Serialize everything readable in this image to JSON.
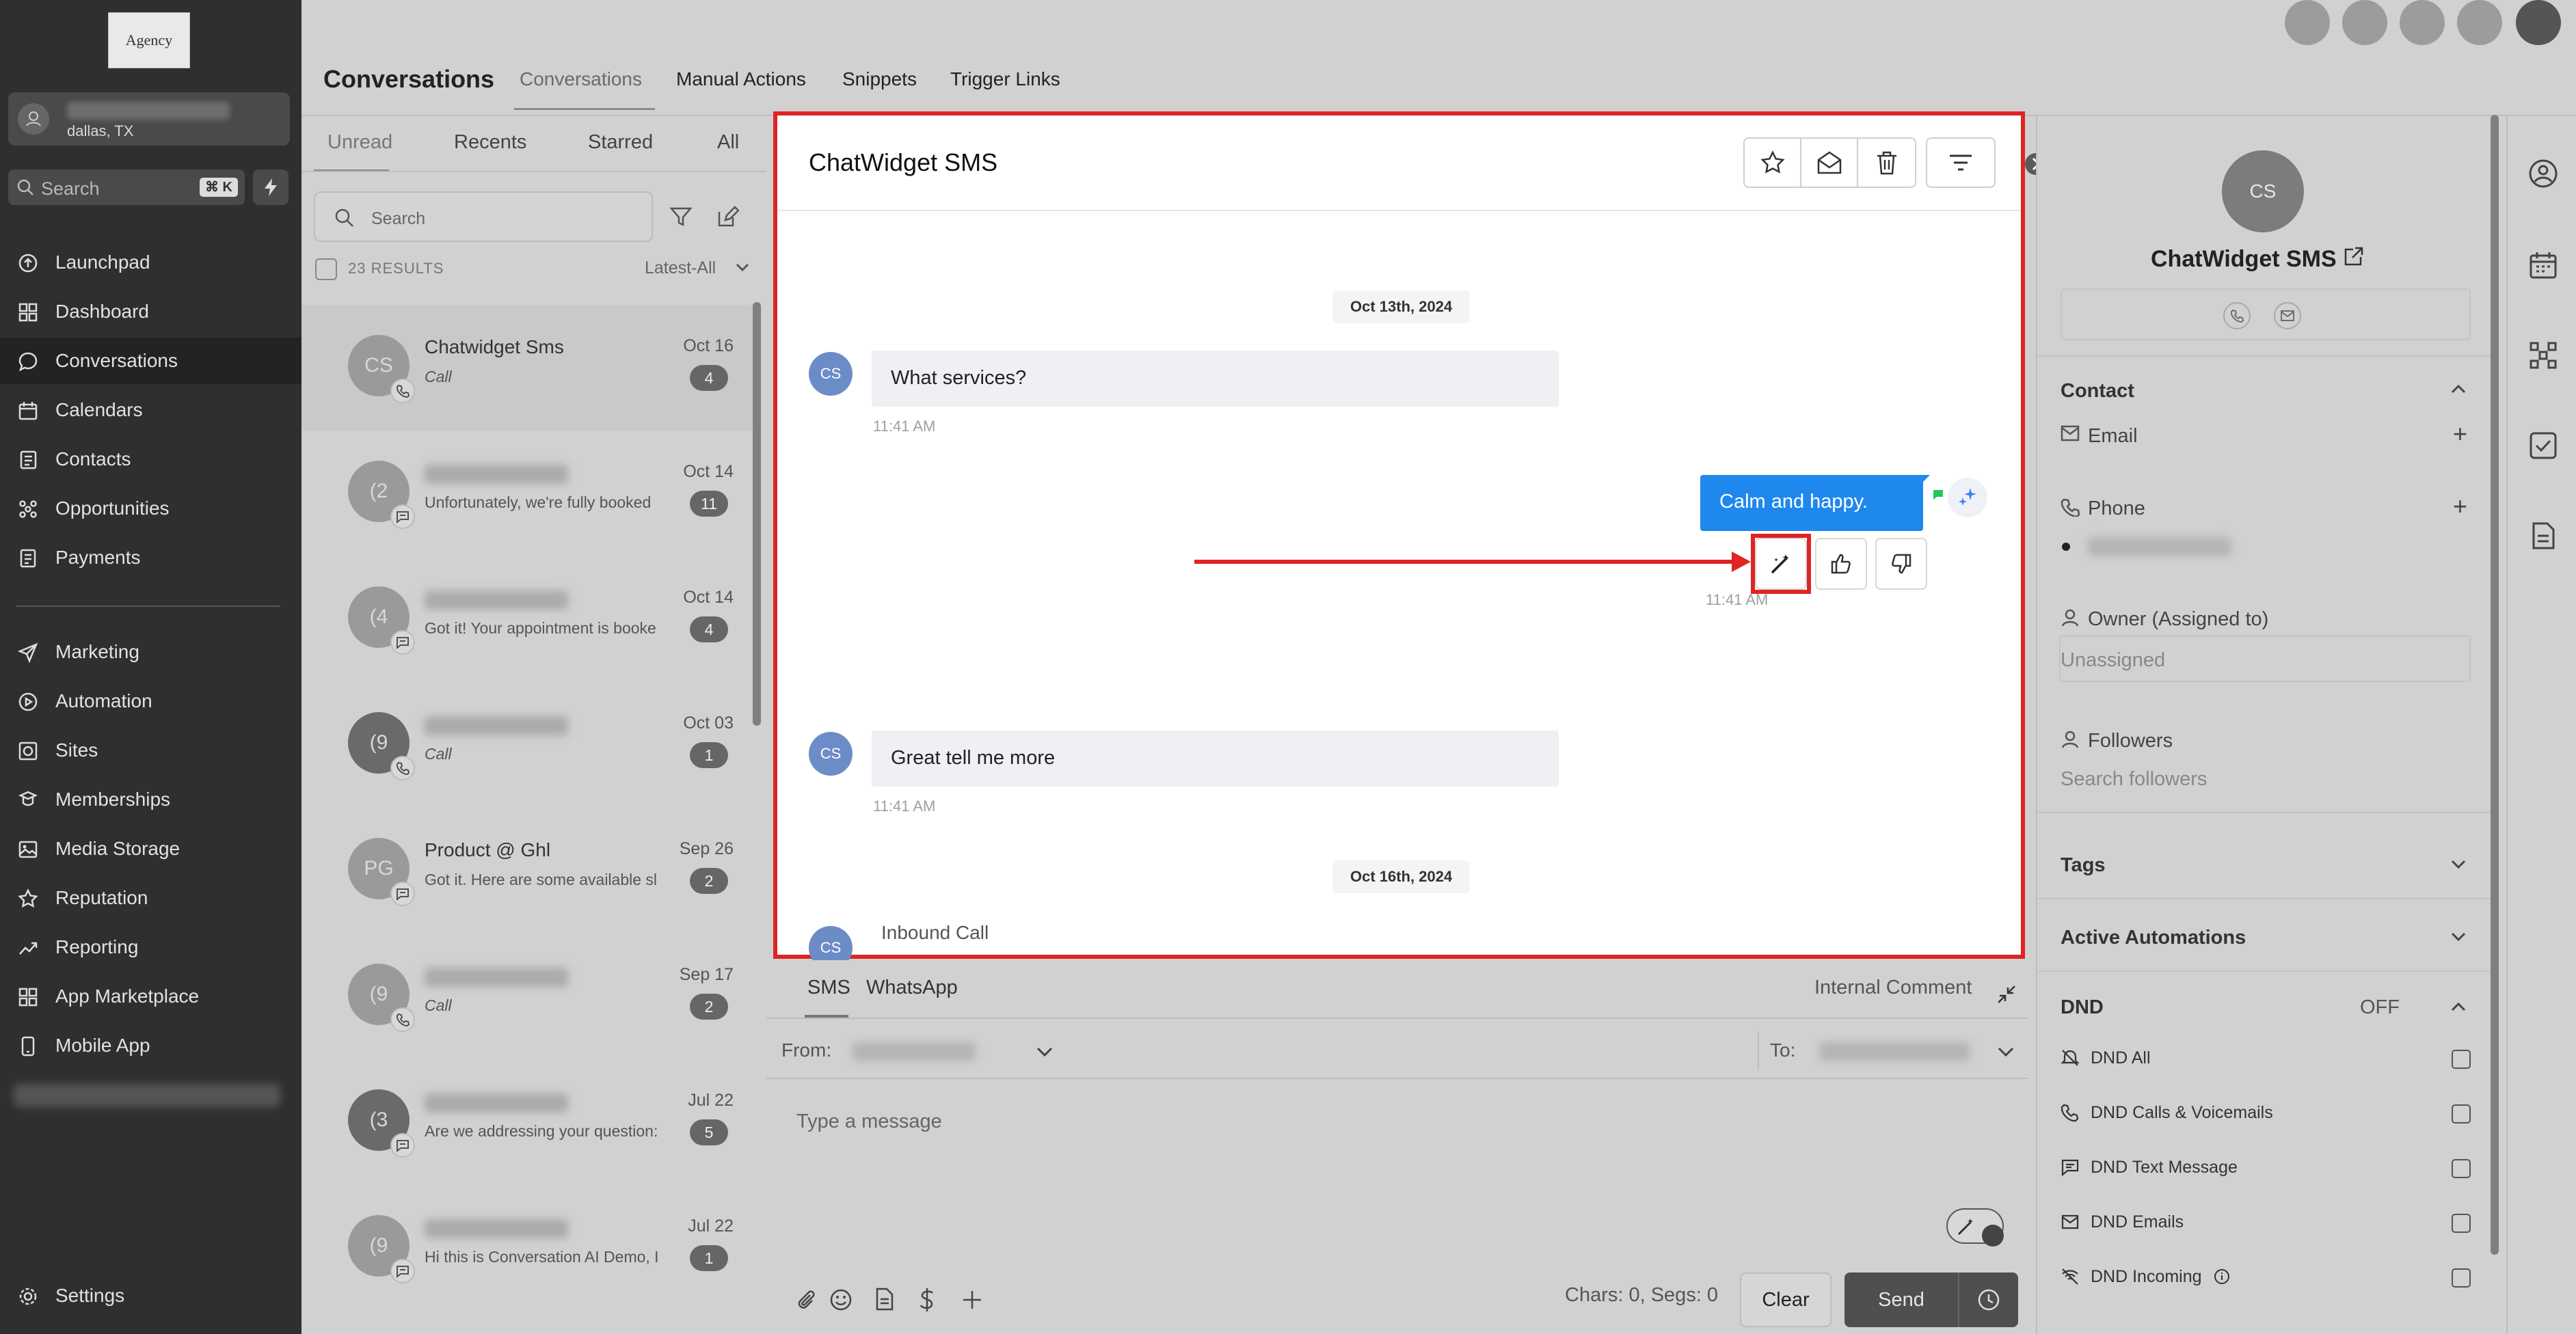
{
  "sidebar": {
    "logo": "Agency",
    "location": "dallas, TX",
    "search_placeholder": "Search",
    "search_shortcut": "⌘ K",
    "nav": [
      {
        "label": "Launchpad",
        "icon": "launchpad-icon"
      },
      {
        "label": "Dashboard",
        "icon": "dashboard-icon"
      },
      {
        "label": "Conversations",
        "icon": "chat-icon",
        "active": true
      },
      {
        "label": "Calendars",
        "icon": "calendar-icon"
      },
      {
        "label": "Contacts",
        "icon": "contacts-icon"
      },
      {
        "label": "Opportunities",
        "icon": "opportunities-icon"
      },
      {
        "label": "Payments",
        "icon": "payments-icon"
      },
      {
        "label": "Marketing",
        "icon": "send-icon"
      },
      {
        "label": "Automation",
        "icon": "automation-icon"
      },
      {
        "label": "Sites",
        "icon": "sites-icon"
      },
      {
        "label": "Memberships",
        "icon": "memberships-icon"
      },
      {
        "label": "Media Storage",
        "icon": "image-icon"
      },
      {
        "label": "Reputation",
        "icon": "star-icon"
      },
      {
        "label": "Reporting",
        "icon": "trend-icon"
      },
      {
        "label": "App Marketplace",
        "icon": "grid-icon"
      },
      {
        "label": "Mobile App",
        "icon": "phone-icon"
      }
    ],
    "settings": "Settings"
  },
  "header": {
    "title": "Conversations",
    "tabs": [
      "Conversations",
      "Manual Actions",
      "Snippets",
      "Trigger Links"
    ]
  },
  "list": {
    "tabs": [
      "Unread",
      "Recents",
      "Starred",
      "All"
    ],
    "search_placeholder": "Search",
    "results": "23 RESULTS",
    "sort": "Latest-All",
    "items": [
      {
        "initials": "CS",
        "name": "Chatwidget Sms",
        "preview": "Call",
        "date": "Oct 16",
        "count": "4",
        "channel": "call"
      },
      {
        "initials": "(2",
        "name": "",
        "preview": "Unfortunately, we're fully booked",
        "date": "Oct 14",
        "count": "11",
        "channel": "sms"
      },
      {
        "initials": "(4",
        "name": "",
        "preview": "Got it! Your appointment is booke",
        "date": "Oct 14",
        "count": "4",
        "channel": "sms"
      },
      {
        "initials": "(9",
        "name": "",
        "preview": "Call",
        "date": "Oct 03",
        "count": "1",
        "channel": "call"
      },
      {
        "initials": "PG",
        "name": "Product @ Ghl",
        "preview": "Got it. Here are some available sl",
        "date": "Sep 26",
        "count": "2",
        "channel": "sms"
      },
      {
        "initials": "(9",
        "name": "",
        "preview": "Call",
        "date": "Sep 17",
        "count": "2",
        "channel": "call"
      },
      {
        "initials": "(3",
        "name": "",
        "preview": "Are we addressing your question:",
        "date": "Jul 22",
        "count": "5",
        "channel": "sms"
      },
      {
        "initials": "(9",
        "name": "",
        "preview": "Hi this is Conversation AI Demo, I",
        "date": "Jul 22",
        "count": "1",
        "channel": "sms"
      }
    ]
  },
  "chat": {
    "title": "ChatWidget SMS",
    "date1": "Oct 13th, 2024",
    "date2": "Oct 16th, 2024",
    "avatar": "CS",
    "msg1": "What services?",
    "time1": "11:41 AM",
    "msg2": "Calm and happy.",
    "time2": "11:41 AM",
    "msg3": "Great tell me more",
    "time3": "11:41 AM",
    "inbound": "Inbound Call"
  },
  "composer": {
    "tabs": [
      "SMS",
      "WhatsApp"
    ],
    "internal_comment": "Internal Comment",
    "from": "From:",
    "to": "To:",
    "placeholder": "Type a message",
    "chars": "Chars: 0, Segs: 0",
    "clear": "Clear",
    "send": "Send"
  },
  "contact": {
    "avatar": "CS",
    "name": "ChatWidget SMS",
    "section_contact": "Contact",
    "email": "Email",
    "phone": "Phone",
    "owner": "Owner (Assigned to)",
    "owner_value": "Unassigned",
    "followers": "Followers",
    "followers_placeholder": "Search followers",
    "tags": "Tags",
    "automations": "Active Automations",
    "dnd": "DND",
    "dnd_status": "OFF",
    "dnd_items": [
      "DND All",
      "DND Calls & Voicemails",
      "DND Text Message",
      "DND Emails",
      "DND Incoming"
    ]
  },
  "colors": {
    "accent": "#1f88ee",
    "highlight": "#e02424"
  }
}
